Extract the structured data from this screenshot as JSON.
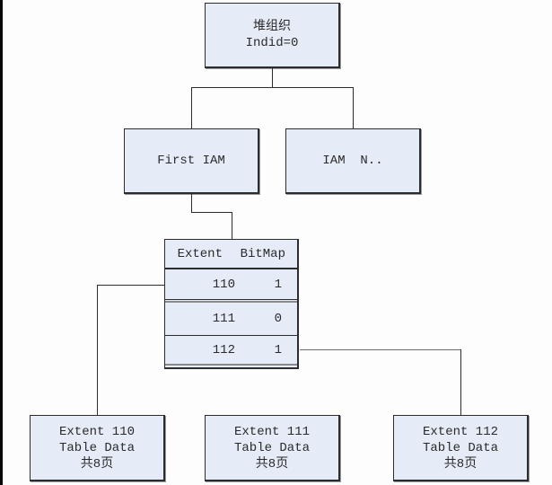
{
  "diagram": {
    "root": {
      "line1": "堆组织",
      "line2": "Indid=0"
    },
    "iam_nodes": [
      {
        "label": "First IAM"
      },
      {
        "label": "IAM  N.."
      }
    ],
    "bitmap_table": {
      "headers": [
        "Extent",
        "BitMap"
      ],
      "rows": [
        {
          "extent": "110",
          "bit": "1"
        },
        {
          "extent": "111",
          "bit": "0"
        },
        {
          "extent": "112",
          "bit": "1"
        }
      ]
    },
    "extent_nodes": [
      {
        "line1": "Extent 110",
        "line2": "Table Data",
        "line3": "共8页"
      },
      {
        "line1": "Extent 111",
        "line2": "Table Data",
        "line3": "共8页"
      },
      {
        "line1": "Extent 112",
        "line2": "Table Data",
        "line3": "共8页"
      }
    ],
    "colors": {
      "box_fill": "#e6ecf7",
      "line": "#2c2c2c"
    }
  }
}
